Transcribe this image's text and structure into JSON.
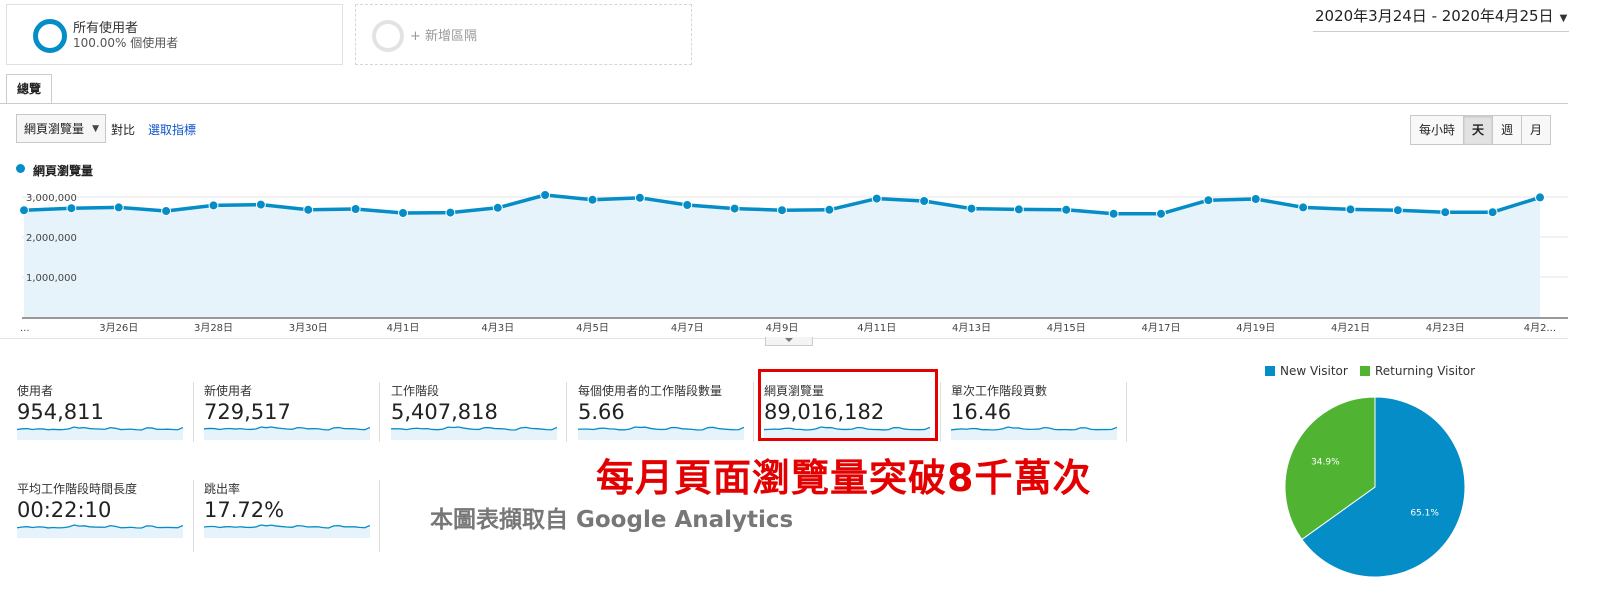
{
  "segments": [
    {
      "title": "所有使用者",
      "subtitle": "100.00% 個使用者"
    },
    {
      "title": "+ 新增區隔"
    }
  ],
  "date_range": "2020年3月24日 - 2020年4月25日",
  "tab": "總覽",
  "controls": {
    "metric_select": "網頁瀏覽量",
    "compare": "對比",
    "choose_metric": "選取指標",
    "ranges": [
      "每小時",
      "天",
      "週",
      "月"
    ],
    "active_range": "天"
  },
  "chart_legend": "網頁瀏覽量",
  "chart_data": [
    {
      "type": "area",
      "series": [
        {
          "name": "網頁瀏覽量",
          "color": "#058dc7"
        }
      ],
      "y_ticks": [
        "1,000,000",
        "2,000,000",
        "3,000,000"
      ],
      "ylim": [
        0,
        3300000
      ],
      "x_tick_labels": [
        "...",
        "3月26日",
        "3月28日",
        "3月30日",
        "4月1日",
        "4月3日",
        "4月5日",
        "4月7日",
        "4月9日",
        "4月11日",
        "4月13日",
        "4月15日",
        "4月17日",
        "4月19日",
        "4月21日",
        "4月23日",
        "4月2..."
      ],
      "x": [
        "3/24",
        "3/25",
        "3/26",
        "3/27",
        "3/28",
        "3/29",
        "3/30",
        "3/31",
        "4/1",
        "4/2",
        "4/3",
        "4/4",
        "4/5",
        "4/6",
        "4/7",
        "4/8",
        "4/9",
        "4/10",
        "4/11",
        "4/12",
        "4/13",
        "4/14",
        "4/15",
        "4/16",
        "4/17",
        "4/18",
        "4/19",
        "4/20",
        "4/21",
        "4/22",
        "4/23",
        "4/24",
        "4/25"
      ],
      "values": [
        2670000,
        2720000,
        2740000,
        2650000,
        2790000,
        2810000,
        2680000,
        2700000,
        2600000,
        2610000,
        2730000,
        3050000,
        2930000,
        2980000,
        2800000,
        2710000,
        2670000,
        2680000,
        2960000,
        2900000,
        2710000,
        2690000,
        2680000,
        2580000,
        2580000,
        2920000,
        2950000,
        2740000,
        2690000,
        2670000,
        2620000,
        2620000,
        2990000
      ],
      "grid": true
    },
    {
      "type": "pie",
      "labels": [
        "New Visitor",
        "Returning Visitor"
      ],
      "values": [
        65.1,
        34.9
      ],
      "slice_labels": [
        "65.1%",
        "34.9%"
      ],
      "colors": [
        "#058dc7",
        "#50b432"
      ],
      "legend": "top"
    }
  ],
  "metrics": [
    {
      "label": "使用者",
      "value": "954,811"
    },
    {
      "label": "新使用者",
      "value": "729,517"
    },
    {
      "label": "工作階段",
      "value": "5,407,818"
    },
    {
      "label": "每個使用者的工作階段數量",
      "value": "5.66"
    },
    {
      "label": "網頁瀏覽量",
      "value": "89,016,182"
    },
    {
      "label": "單次工作階段頁數",
      "value": "16.46"
    },
    {
      "label": "平均工作階段時間長度",
      "value": "00:22:10"
    },
    {
      "label": "跳出率",
      "value": "17.72%"
    }
  ],
  "annotation": "每月頁面瀏覽量突破8千萬次",
  "caption": "本圖表擷取自 Google Analytics",
  "colors": {
    "accent": "#058dc7",
    "green": "#50b432",
    "annotation_red": "#e30000"
  }
}
